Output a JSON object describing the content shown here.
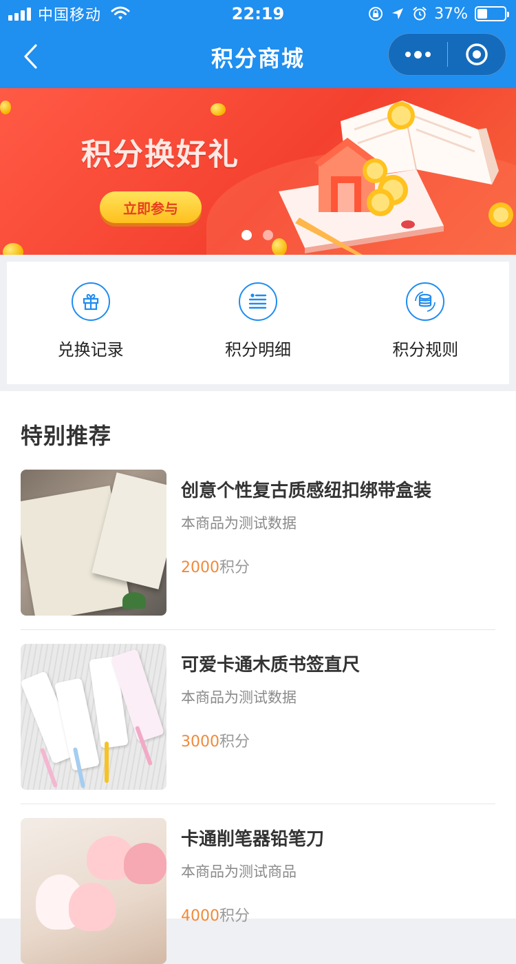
{
  "status_bar": {
    "carrier": "中国移动",
    "time": "22:19",
    "battery_percent": "37%",
    "battery_level": 0.37,
    "icons": [
      "signal-icon",
      "wifi-icon",
      "orientation-lock-icon",
      "location-icon",
      "alarm-icon",
      "battery-icon"
    ]
  },
  "nav": {
    "title": "积分商城",
    "back_icon": "chevron-left-icon",
    "more_icon": "more-dots-icon",
    "close_icon": "target-circle-icon"
  },
  "banner": {
    "title": "积分换好礼",
    "button_label": "立即参与",
    "slides": 2,
    "active_slide": 1,
    "colors": {
      "background": "#f4412f",
      "button": "#ffcf2e",
      "button_text": "#e5411f"
    }
  },
  "quick_entries": [
    {
      "label": "兑换记录",
      "icon": "gift-icon"
    },
    {
      "label": "积分明细",
      "icon": "list-icon"
    },
    {
      "label": "积分规则",
      "icon": "coins-icon"
    }
  ],
  "recommend": {
    "title": "特别推荐",
    "items": [
      {
        "name": "创意个性复古质感纽扣绑带盒装",
        "desc": "本商品为测试数据",
        "price": "2000",
        "unit": "积分"
      },
      {
        "name": "可爱卡通木质书签直尺",
        "desc": "本商品为测试数据",
        "price": "3000",
        "unit": "积分"
      },
      {
        "name": "卡通削笔器铅笔刀",
        "desc": "本商品为测试商品",
        "price": "4000",
        "unit": "积分"
      }
    ]
  },
  "colors": {
    "header": "#1f8ff0",
    "accent_blue": "#1e8cf0",
    "price": "#f08a3a",
    "page_bg": "#eef0f4"
  }
}
